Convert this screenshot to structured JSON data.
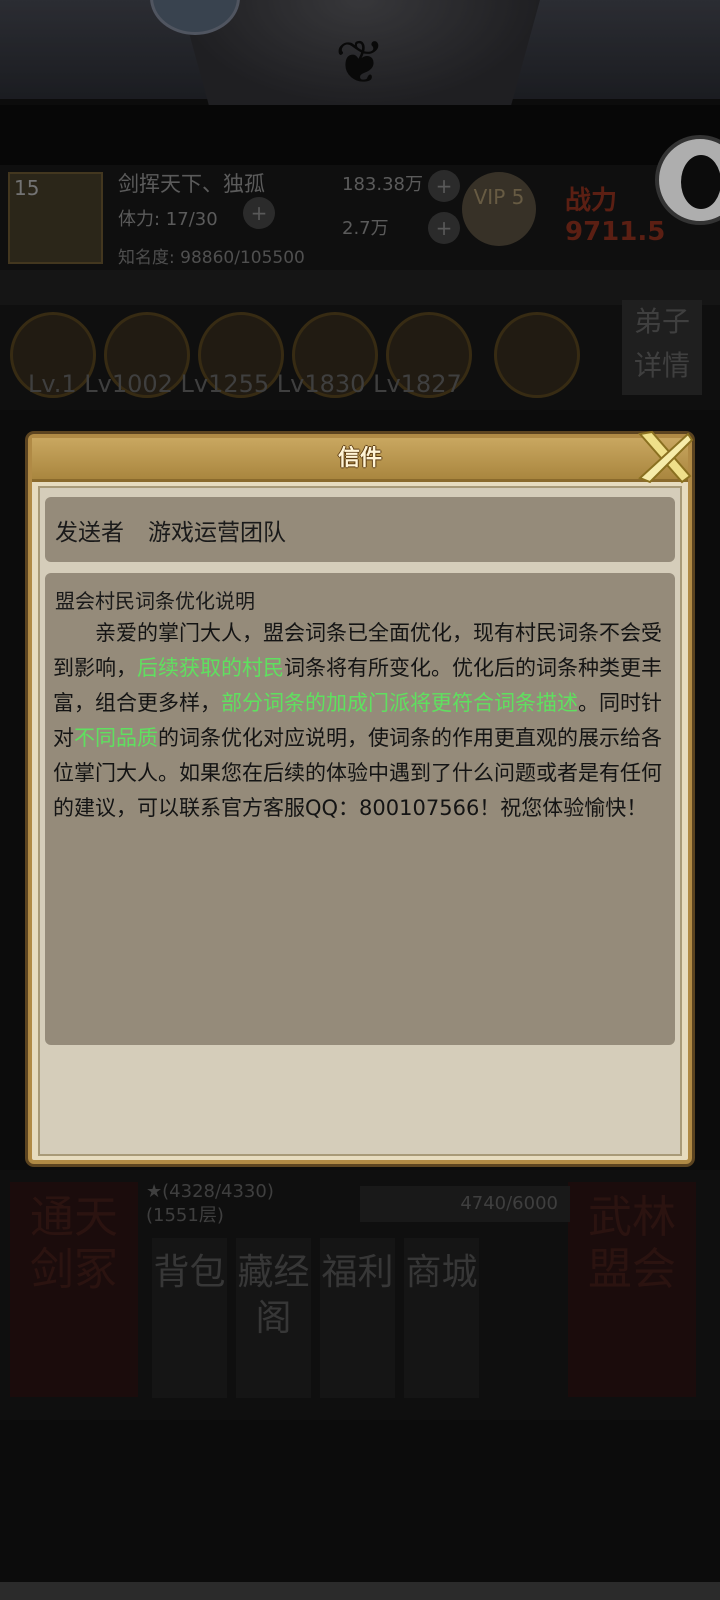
{
  "background": {
    "player": {
      "level": "15",
      "name": "剑挥天下、独孤",
      "stamina": "体力: 17/30",
      "fame": "知名度: 98860/105500",
      "gold": "183.38万",
      "ingot": "2.7万",
      "vip": "VIP 5",
      "power": "战力 9711.5"
    },
    "disciple_levels": "Lv.1  Lv1002 Lv1255 Lv1830 Lv1827",
    "disciple_button": "弟子详情",
    "bottom": {
      "left_big": "通天剑冢",
      "right_big": "武林盟会",
      "stat_stars": "★(4328/4330)",
      "stat_floor": "(1551层)",
      "stat_progress": "4740/6000",
      "buttons": [
        "背包",
        "藏经阁",
        "福利",
        "商城"
      ]
    }
  },
  "dialog": {
    "title": "信件",
    "sender_label": "发送者",
    "sender_value": "游戏运营团队",
    "subject": "盟会村民词条优化说明",
    "body_segments": [
      {
        "text": "　　亲爱的掌门大人，盟会词条已全面优化，现有村民词条不会受到影响，",
        "highlight": false
      },
      {
        "text": "后续获取的村民",
        "highlight": true
      },
      {
        "text": "词条将有所变化。优化后的词条种类更丰富，组合更多样，",
        "highlight": false
      },
      {
        "text": "部分词条的加成门派将更符合词条描述",
        "highlight": true
      },
      {
        "text": "。同时针对",
        "highlight": false
      },
      {
        "text": "不同品质",
        "highlight": true
      },
      {
        "text": "的词条优化对应说明，使词条的作用更直观的展示给各位掌门大人。如果您在后续的体验中遇到了什么问题或者是有任何的建议，可以联系官方客服QQ：800107566！祝您体验愉快！",
        "highlight": false
      }
    ]
  },
  "colors": {
    "highlight": "#5fe05f",
    "dialog_frame": "#b08a45",
    "dialog_fill": "#d5cdba",
    "panel_fill": "#958b7a"
  }
}
